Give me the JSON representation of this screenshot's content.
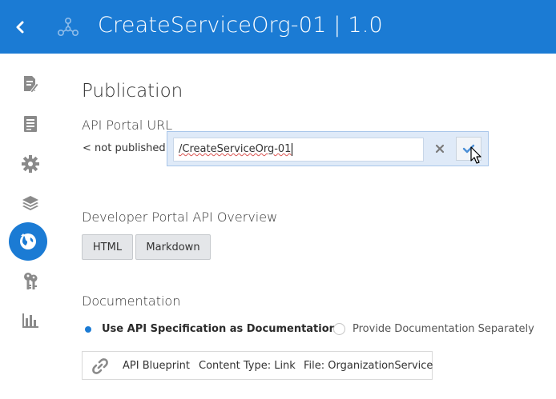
{
  "header": {
    "title": "CreateServiceOrg-01 | 1.0",
    "background": "#1b7bd4",
    "back_icon": "chevron-left-icon",
    "app_icon": "api-nodes-icon"
  },
  "sidebar": {
    "items": [
      {
        "icon": "document-edit-icon"
      },
      {
        "icon": "list-document-icon"
      },
      {
        "icon": "gear-icon"
      },
      {
        "icon": "layers-icon"
      },
      {
        "icon": "globe-publish-icon",
        "active": true
      },
      {
        "icon": "keys-icon"
      },
      {
        "icon": "bar-chart-icon"
      }
    ],
    "active_color": "#1b7bd4"
  },
  "main": {
    "title": "Publication",
    "api_portal": {
      "label": "API Portal URL",
      "prefix": "< not published >",
      "input_value": "/CreateServiceOrg-01"
    },
    "dev_portal": {
      "label": "Developer Portal API Overview",
      "buttons": [
        "HTML",
        "Markdown"
      ]
    },
    "documentation": {
      "label": "Documentation",
      "options": [
        {
          "label": "Use API Specification as Documentation",
          "selected": true
        },
        {
          "label": "Provide Documentation Separately",
          "selected": false
        }
      ],
      "file": {
        "name": "API Blueprint",
        "content_type": "Content Type: Link",
        "file": "File: OrganizationService"
      }
    }
  }
}
